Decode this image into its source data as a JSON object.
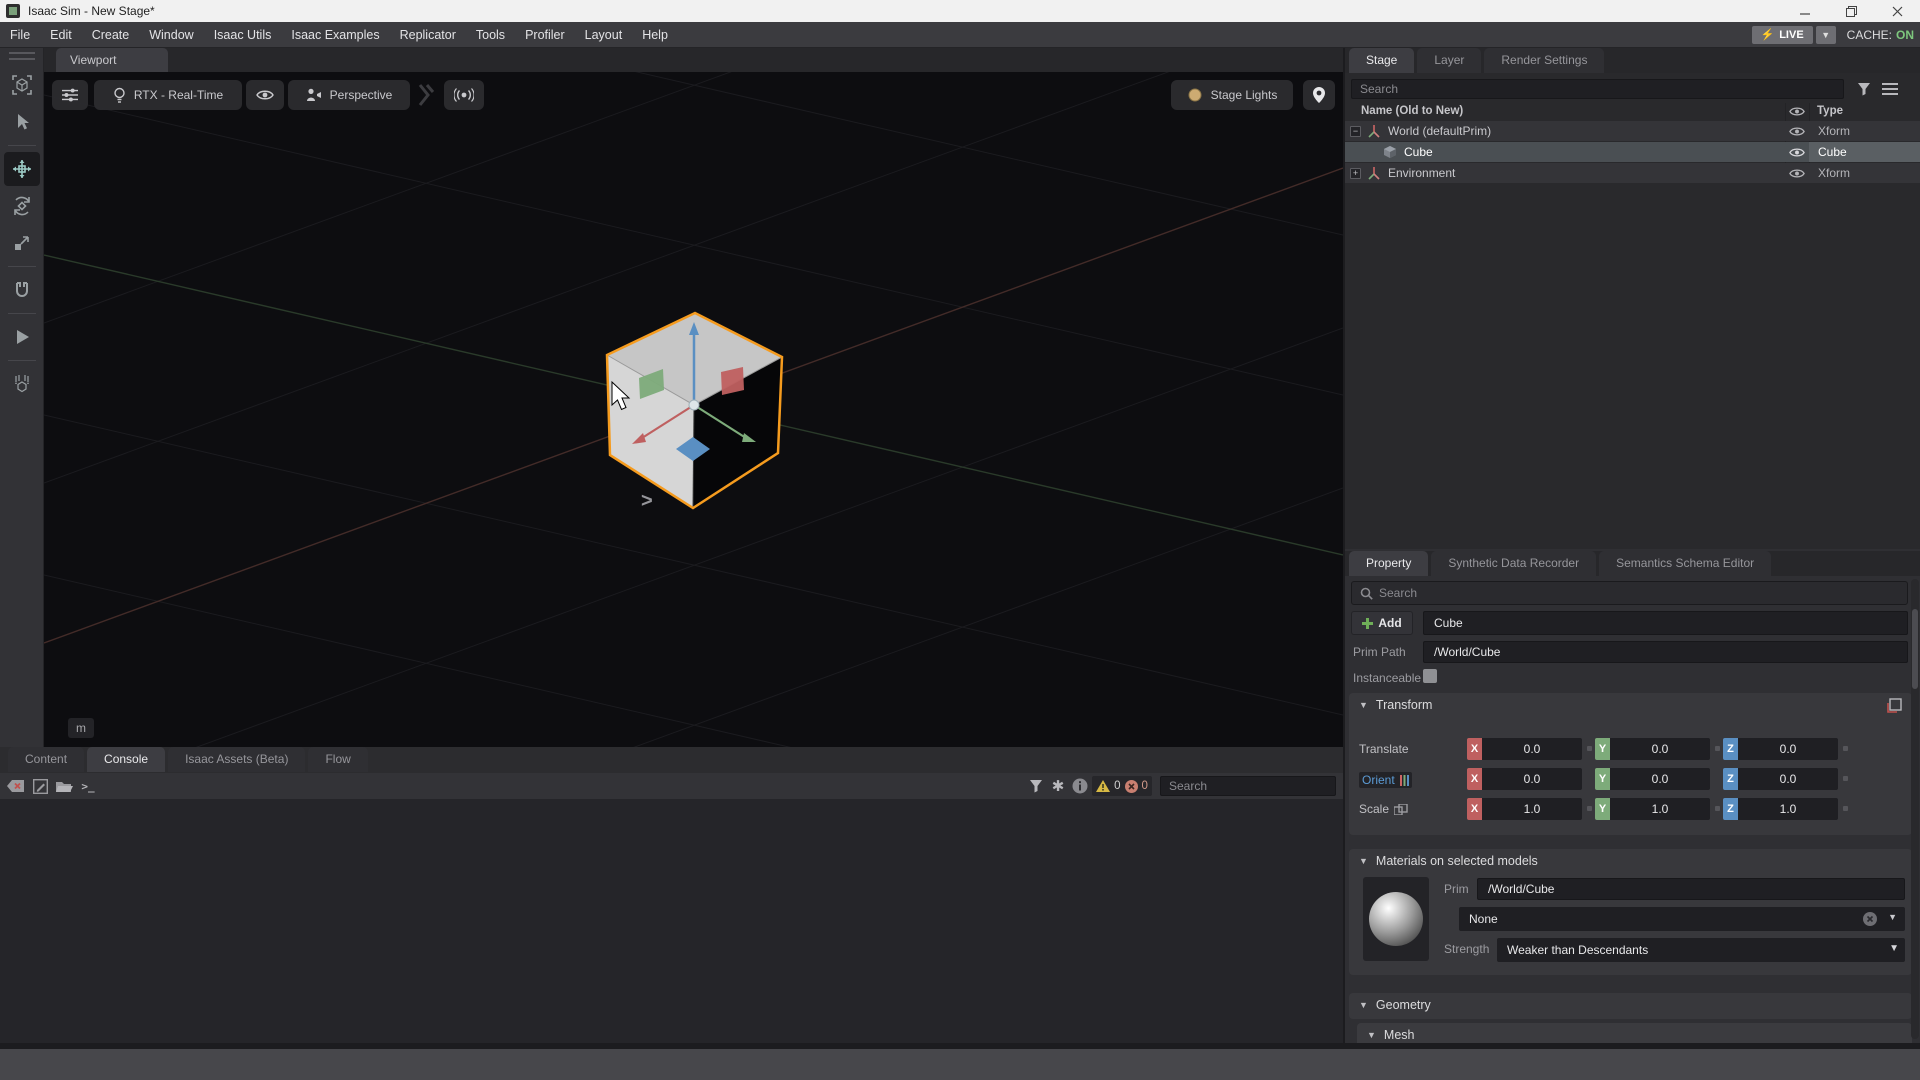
{
  "titlebar": {
    "title": "Isaac Sim  - New Stage*"
  },
  "menu": {
    "items": [
      "File",
      "Edit",
      "Create",
      "Window",
      "Isaac Utils",
      "Isaac Examples",
      "Replicator",
      "Tools",
      "Profiler",
      "Layout",
      "Help"
    ]
  },
  "topright": {
    "live_label": "LIVE",
    "cache_label": "CACHE:",
    "cache_value": "ON"
  },
  "left_toolbar": {
    "active_tool": "move",
    "tools": [
      "select-frame",
      "cursor-select",
      "move",
      "rotate",
      "scale",
      "snap",
      "play",
      "physics-drop"
    ]
  },
  "viewport": {
    "tab_label": "Viewport",
    "renderer": "RTX - Real-Time",
    "camera": "Perspective",
    "stage_lights": "Stage Lights",
    "unit_badge": "m",
    "gizmo_expand_chevron": ">"
  },
  "stage_panel": {
    "tabs": [
      "Stage",
      "Layer",
      "Render Settings"
    ],
    "active_tab": "Stage",
    "search_placeholder": "Search",
    "columns": {
      "name": "Name (Old to New)",
      "type": "Type"
    },
    "rows": [
      {
        "name": "World (defaultPrim)",
        "type": "Xform",
        "expander": "−",
        "icon": "xform-icon",
        "selected": false
      },
      {
        "name": "Cube",
        "type": "Cube",
        "expander": "",
        "icon": "cube-icon",
        "selected": true
      },
      {
        "name": "Environment",
        "type": "Xform",
        "expander": "+",
        "icon": "xform-icon",
        "selected": false
      }
    ]
  },
  "property_panel": {
    "tabs": [
      "Property",
      "Synthetic Data Recorder",
      "Semantics Schema Editor"
    ],
    "active_tab": "Property",
    "search_placeholder": "Search",
    "add_label": "Add",
    "name_value": "Cube",
    "prim_path_label": "Prim Path",
    "prim_path_value": "/World/Cube",
    "instanceable_label": "Instanceable",
    "transform": {
      "title": "Transform",
      "axes": [
        "X",
        "Y",
        "Z"
      ],
      "rows": [
        {
          "label": "Translate",
          "values": [
            "0.0",
            "0.0",
            "0.0"
          ]
        },
        {
          "label": "Orient",
          "values": [
            "0.0",
            "0.0",
            "0.0"
          ]
        },
        {
          "label": "Scale",
          "values": [
            "1.0",
            "1.0",
            "1.0"
          ]
        }
      ]
    },
    "materials": {
      "title": "Materials on selected models",
      "prim_label": "Prim",
      "prim_value": "/World/Cube",
      "material_value": "None",
      "strength_label": "Strength",
      "strength_value": "Weaker than Descendants"
    },
    "geometry_title": "Geometry",
    "mesh_title": "Mesh"
  },
  "bottom_panel": {
    "tabs": [
      "Content",
      "Console",
      "Isaac Assets (Beta)",
      "Flow"
    ],
    "active_tab": "Console",
    "prompt_glyph": ">_",
    "warning_count": "0",
    "error_count": "0",
    "search_placeholder": "Search"
  },
  "colors": {
    "selection_outline_orange": "#f59b1e",
    "axis_x_red": "#bf6060",
    "axis_y_green": "#7dab7a",
    "axis_z_blue": "#5a8fc2",
    "orient_label_blue": "#5b9bd5",
    "live_bolt_yellow": "#e7c53c",
    "cache_on_green": "#7ec77e",
    "warning_yellow": "#d7b944",
    "error_salmon": "#c97f70"
  }
}
